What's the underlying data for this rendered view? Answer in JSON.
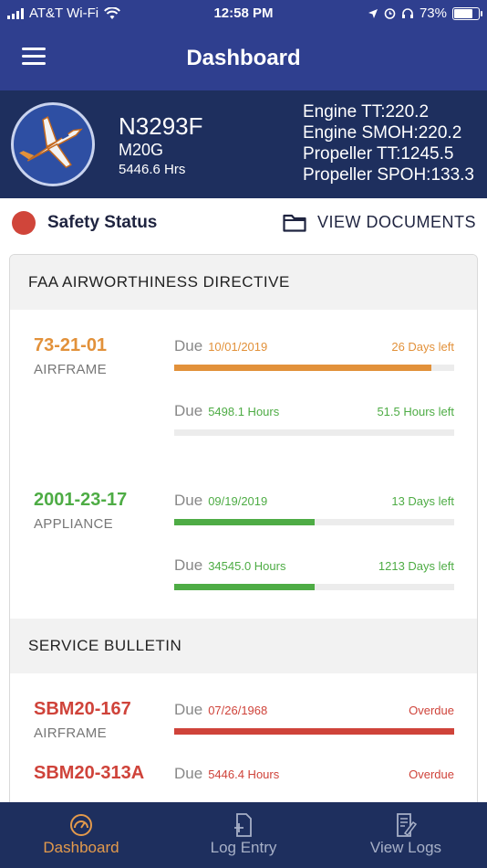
{
  "status_bar": {
    "carrier": "AT&T Wi-Fi",
    "time": "12:58 PM",
    "battery": "73%"
  },
  "nav": {
    "title": "Dashboard"
  },
  "aircraft": {
    "registration": "N3293F",
    "model": "M20G",
    "hours": "5446.6 Hrs",
    "specs": [
      "Engine TT:220.2",
      "Engine SMOH:220.2",
      "Propeller TT:1245.5",
      "Propeller SPOH:133.3"
    ]
  },
  "safety": {
    "label": "Safety Status",
    "view_documents": "VIEW DOCUMENTS",
    "status_color": "#d0453a"
  },
  "sections": [
    {
      "title": "FAA AIRWORTHINESS DIRECTIVE",
      "items": [
        {
          "code": "73-21-01",
          "category": "AIRFRAME",
          "color": "#e2913a",
          "rows": [
            {
              "due_label": "Due",
              "due_value": "10/01/2019",
              "remaining": "26 Days left",
              "progress": 0.92
            },
            {
              "due_label": "Due",
              "due_value": "5498.1 Hours",
              "remaining": "51.5 Hours left",
              "progress": 0.0
            }
          ]
        },
        {
          "code": "2001-23-17",
          "category": "APPLIANCE",
          "color": "#4eac45",
          "rows": [
            {
              "due_label": "Due",
              "due_value": "09/19/2019",
              "remaining": "13 Days left",
              "progress": 0.5
            },
            {
              "due_label": "Due",
              "due_value": "34545.0 Hours",
              "remaining": "1213 Days left",
              "progress": 0.5
            }
          ]
        }
      ]
    },
    {
      "title": "SERVICE BULLETIN",
      "items": [
        {
          "code": "SBM20-167",
          "category": "AIRFRAME",
          "color": "#cf433a",
          "rows": [
            {
              "due_label": "Due",
              "due_value": "07/26/1968",
              "remaining": "Overdue",
              "progress": 1.0
            }
          ]
        },
        {
          "code": "SBM20-313A",
          "category": "",
          "color": "#cf433a",
          "rows": [
            {
              "due_label": "Due",
              "due_value": "5446.4 Hours",
              "remaining": "Overdue",
              "progress": 1.0
            }
          ]
        }
      ]
    }
  ],
  "tabs": [
    {
      "label": "Dashboard",
      "icon": "gauge-icon",
      "active": true
    },
    {
      "label": "Log Entry",
      "icon": "add-document-icon",
      "active": false
    },
    {
      "label": "View Logs",
      "icon": "edit-document-icon",
      "active": false
    }
  ]
}
